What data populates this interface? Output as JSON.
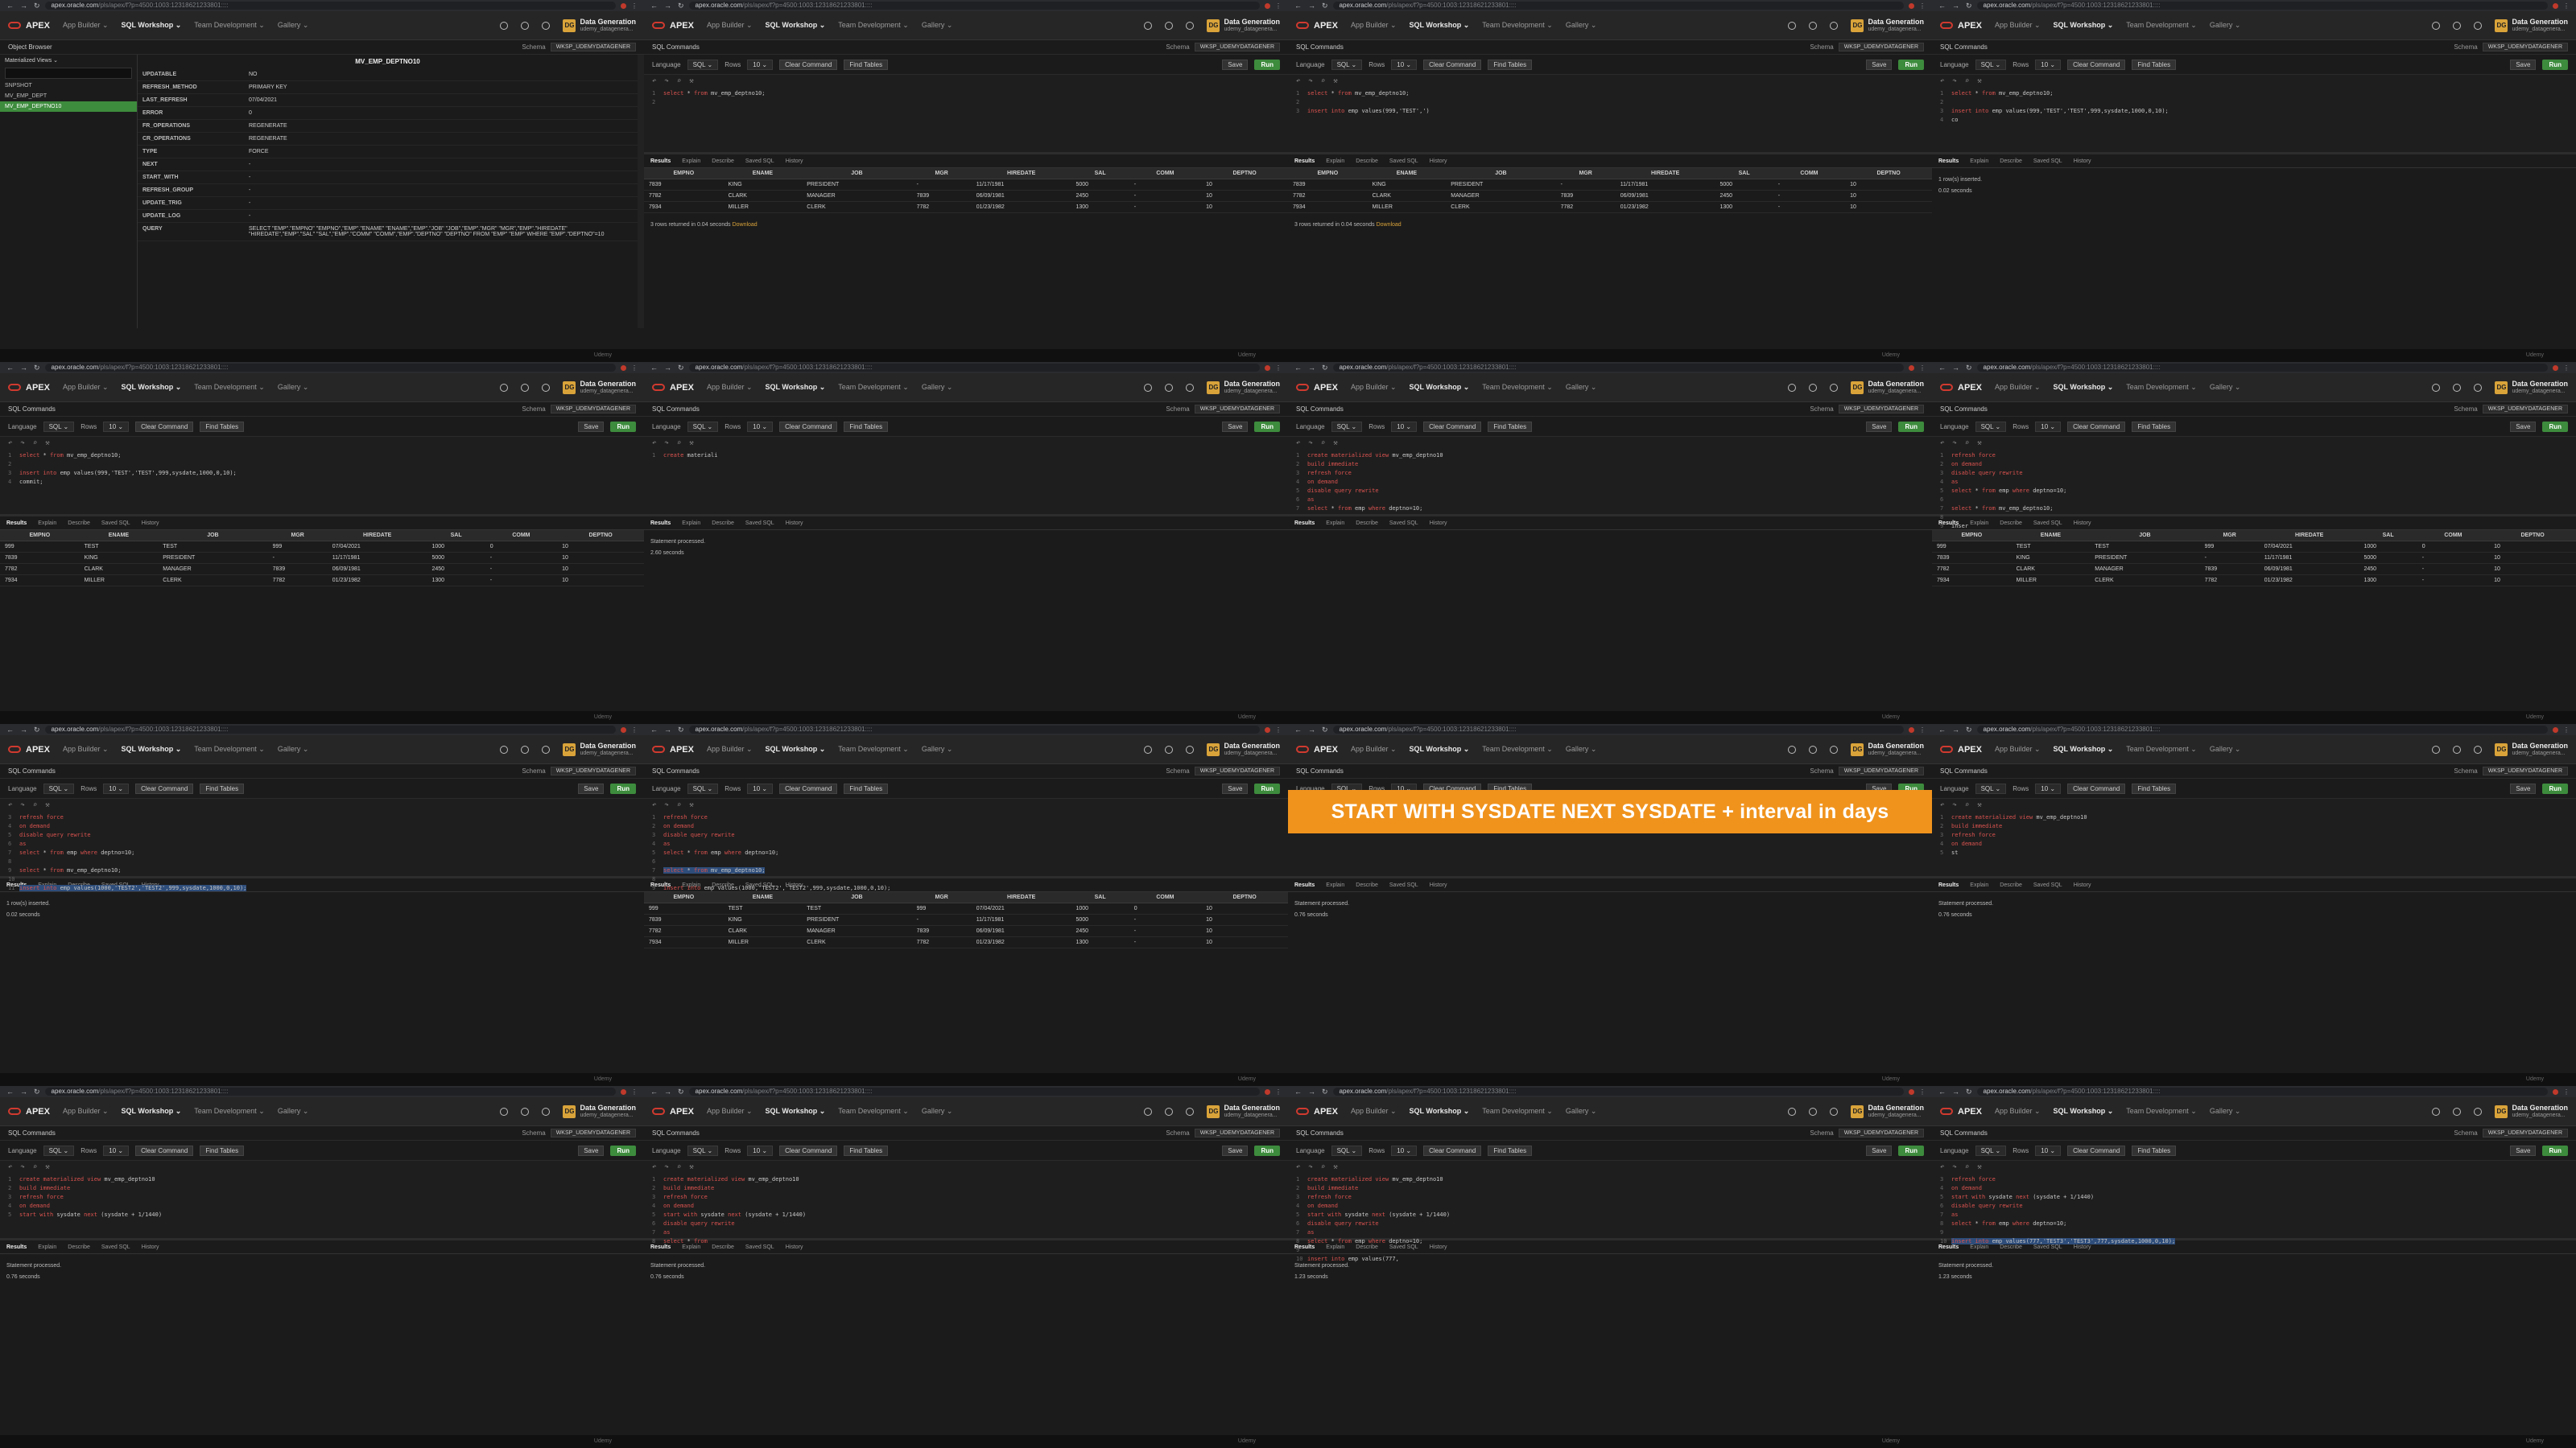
{
  "browser": {
    "url_host": "apex.oracle.com",
    "url_rest": "/pls/apex/f?p=4500:1003:12318621233801::::"
  },
  "apex": {
    "logo": "APEX",
    "menus": [
      "App Builder",
      "SQL Workshop",
      "Team Development",
      "Gallery"
    ],
    "active_menu": "SQL Workshop",
    "workspace_badge": "DG",
    "workspace_title": "Data Generation",
    "workspace_user": "udemy_datagenera..."
  },
  "page": {
    "title": "SQL Commands",
    "schema_label": "Schema",
    "schema_value": "WKSP_UDEMYDATAGENER"
  },
  "toolbar": {
    "language_label": "Language",
    "language_value": "SQL",
    "rows_label": "Rows",
    "rows_value": "10",
    "clear_label": "Clear Command",
    "find_label": "Find Tables",
    "save_label": "Save",
    "run_label": "Run"
  },
  "result_tabs": [
    "Results",
    "Explain",
    "Describe",
    "Saved SQL",
    "History"
  ],
  "footer_brand": "Udemy",
  "emp_columns": [
    "EMPNO",
    "ENAME",
    "JOB",
    "MGR",
    "HIREDATE",
    "SAL",
    "COMM",
    "DEPTNO"
  ],
  "object_browser": {
    "title": "Object Browser",
    "view_select": "Materialized Views",
    "items": [
      "SNPSHOT",
      "MV_EMP_DEPT",
      "MV_EMP_DEPTNO10"
    ],
    "selected_item": "MV_EMP_DEPTNO10",
    "heading": "MV_EMP_DEPTNO10",
    "properties": [
      {
        "k": "UPDATABLE",
        "v": "NO"
      },
      {
        "k": "REFRESH_METHOD",
        "v": "PRIMARY KEY"
      },
      {
        "k": "LAST_REFRESH",
        "v": "07/04/2021"
      },
      {
        "k": "ERROR",
        "v": "0"
      },
      {
        "k": "FR_OPERATIONS",
        "v": "REGENERATE"
      },
      {
        "k": "CR_OPERATIONS",
        "v": "REGENERATE"
      },
      {
        "k": "TYPE",
        "v": "FORCE"
      },
      {
        "k": "NEXT",
        "v": "-"
      },
      {
        "k": "START_WITH",
        "v": "-"
      },
      {
        "k": "REFRESH_GROUP",
        "v": "-"
      },
      {
        "k": "UPDATE_TRIG",
        "v": "-"
      },
      {
        "k": "UPDATE_LOG",
        "v": "-"
      },
      {
        "k": "QUERY",
        "v": "SELECT \"EMP\".\"EMPNO\" \"EMPNO\",\"EMP\".\"ENAME\" \"ENAME\",\"EMP\".\"JOB\" \"JOB\",\"EMP\".\"MGR\" \"MGR\",\"EMP\".\"HIREDATE\" \"HIREDATE\",\"EMP\".\"SAL\" \"SAL\",\"EMP\".\"COMM\" \"COMM\",\"EMP\".\"DEPTNO\" \"DEPTNO\" FROM \"EMP\" \"EMP\" WHERE \"EMP\".\"DEPTNO\"=10"
      }
    ]
  },
  "banner_text": "START WITH SYSDATE NEXT SYSDATE + interval in days",
  "tiles": [
    {
      "kind": "objbrowser"
    },
    {
      "kind": "sql",
      "code": [
        {
          "n": "1",
          "t": "select * from mv_emp_deptno10;"
        },
        {
          "n": "2",
          "t": ""
        }
      ],
      "result": "table",
      "rows": [
        [
          "7839",
          "KING",
          "PRESIDENT",
          "-",
          "11/17/1981",
          "5000",
          "-",
          "10"
        ],
        [
          "7782",
          "CLARK",
          "MANAGER",
          "7839",
          "06/09/1981",
          "2450",
          "-",
          "10"
        ],
        [
          "7934",
          "MILLER",
          "CLERK",
          "7782",
          "01/23/1982",
          "1300",
          "-",
          "10"
        ]
      ],
      "status": "3 rows returned in 0.04 seconds",
      "download": "Download"
    },
    {
      "kind": "sql",
      "code": [
        {
          "n": "1",
          "t": "select * from mv_emp_deptno10;"
        },
        {
          "n": "2",
          "t": ""
        },
        {
          "n": "3",
          "t": "insert into emp values(999,'TEST',')"
        }
      ],
      "result": "table",
      "rows": [
        [
          "7839",
          "KING",
          "PRESIDENT",
          "-",
          "11/17/1981",
          "5000",
          "-",
          "10"
        ],
        [
          "7782",
          "CLARK",
          "MANAGER",
          "7839",
          "06/09/1981",
          "2450",
          "-",
          "10"
        ],
        [
          "7934",
          "MILLER",
          "CLERK",
          "7782",
          "01/23/1982",
          "1300",
          "-",
          "10"
        ]
      ],
      "status": "3 rows returned in 0.04 seconds",
      "download": "Download"
    },
    {
      "kind": "sql",
      "code": [
        {
          "n": "1",
          "t": "select * from mv_emp_deptno10;"
        },
        {
          "n": "2",
          "t": ""
        },
        {
          "n": "3",
          "t": "insert into emp values(999,'TEST','TEST',999,sysdate,1000,0,10);"
        },
        {
          "n": "4",
          "t": "co"
        }
      ],
      "result": "msg",
      "messages": [
        "1 row(s) inserted.",
        "0.02 seconds"
      ]
    },
    {
      "kind": "sql",
      "code": [
        {
          "n": "1",
          "t": "select * from mv_emp_deptno10;"
        },
        {
          "n": "2",
          "t": ""
        },
        {
          "n": "3",
          "t": "insert into emp values(999,'TEST','TEST',999,sysdate,1000,0,10);"
        },
        {
          "n": "4",
          "t": "commit;"
        }
      ],
      "result": "table",
      "rows": [
        [
          "999",
          "TEST",
          "TEST",
          "999",
          "07/04/2021",
          "1000",
          "0",
          "10"
        ],
        [
          "7839",
          "KING",
          "PRESIDENT",
          "-",
          "11/17/1981",
          "5000",
          "-",
          "10"
        ],
        [
          "7782",
          "CLARK",
          "MANAGER",
          "7839",
          "06/09/1981",
          "2450",
          "-",
          "10"
        ],
        [
          "7934",
          "MILLER",
          "CLERK",
          "7782",
          "01/23/1982",
          "1300",
          "-",
          "10"
        ]
      ],
      "status": "",
      "download": ""
    },
    {
      "kind": "sql",
      "code": [
        {
          "n": "1",
          "t": "create materiali"
        }
      ],
      "result": "msg",
      "messages": [
        "Statement processed.",
        "2.60 seconds"
      ]
    },
    {
      "kind": "sql",
      "code": [
        {
          "n": "1",
          "t": "create materialized view mv_emp_deptno10"
        },
        {
          "n": "2",
          "t": "build immediate"
        },
        {
          "n": "3",
          "t": "refresh force"
        },
        {
          "n": "4",
          "t": "on demand"
        },
        {
          "n": "5",
          "t": "disable query rewrite"
        },
        {
          "n": "6",
          "t": "as"
        },
        {
          "n": "7",
          "t": "select * from emp where deptno=10;"
        }
      ],
      "result": "none"
    },
    {
      "kind": "sql",
      "code": [
        {
          "n": "1",
          "t": "refresh force"
        },
        {
          "n": "2",
          "t": "on demand"
        },
        {
          "n": "3",
          "t": "disable query rewrite"
        },
        {
          "n": "4",
          "t": "as"
        },
        {
          "n": "5",
          "t": "select * from emp where deptno=10;"
        },
        {
          "n": "6",
          "t": ""
        },
        {
          "n": "7",
          "t": "select * from mv_emp_deptno10;"
        },
        {
          "n": "8",
          "t": ""
        },
        {
          "n": "9",
          "t": "inser"
        }
      ],
      "result": "table",
      "rows": [
        [
          "999",
          "TEST",
          "TEST",
          "999",
          "07/04/2021",
          "1000",
          "0",
          "10"
        ],
        [
          "7839",
          "KING",
          "PRESIDENT",
          "-",
          "11/17/1981",
          "5000",
          "-",
          "10"
        ],
        [
          "7782",
          "CLARK",
          "MANAGER",
          "7839",
          "06/09/1981",
          "2450",
          "-",
          "10"
        ],
        [
          "7934",
          "MILLER",
          "CLERK",
          "7782",
          "01/23/1982",
          "1300",
          "-",
          "10"
        ]
      ],
      "status": "",
      "download": ""
    },
    {
      "kind": "sql",
      "code": [
        {
          "n": "3",
          "t": "refresh force"
        },
        {
          "n": "4",
          "t": "on demand"
        },
        {
          "n": "5",
          "t": "disable query rewrite"
        },
        {
          "n": "6",
          "t": "as"
        },
        {
          "n": "7",
          "t": "select * from emp where deptno=10;"
        },
        {
          "n": "8",
          "t": ""
        },
        {
          "n": "9",
          "t": "select * from mv_emp_deptno10;"
        },
        {
          "n": "10",
          "t": ""
        },
        {
          "n": "11",
          "t": "insert into emp values(1000,'TEST2','TEST2',999,sysdate,1000,0,10);",
          "hl": true
        }
      ],
      "result": "msg",
      "messages": [
        "1 row(s) inserted.",
        "0.02 seconds"
      ]
    },
    {
      "kind": "sql",
      "code": [
        {
          "n": "1",
          "t": "refresh force"
        },
        {
          "n": "2",
          "t": "on demand"
        },
        {
          "n": "3",
          "t": "disable query rewrite"
        },
        {
          "n": "4",
          "t": "as"
        },
        {
          "n": "5",
          "t": "select * from emp where deptno=10;"
        },
        {
          "n": "6",
          "t": ""
        },
        {
          "n": "7",
          "t": "select * from mv_emp_deptno10;",
          "hl": true
        },
        {
          "n": "8",
          "t": ""
        },
        {
          "n": "9",
          "t": "insert into emp values(1000,'TEST2','TEST2',999,sysdate,1000,0,10);"
        }
      ],
      "result": "table",
      "rows": [
        [
          "999",
          "TEST",
          "TEST",
          "999",
          "07/04/2021",
          "1000",
          "0",
          "10"
        ],
        [
          "7839",
          "KING",
          "PRESIDENT",
          "-",
          "11/17/1981",
          "5000",
          "-",
          "10"
        ],
        [
          "7782",
          "CLARK",
          "MANAGER",
          "7839",
          "06/09/1981",
          "2450",
          "-",
          "10"
        ],
        [
          "7934",
          "MILLER",
          "CLERK",
          "7782",
          "01/23/1982",
          "1300",
          "-",
          "10"
        ]
      ],
      "status": "",
      "download": ""
    },
    {
      "kind": "sql",
      "banner": true,
      "code": [
        {
          "n": "1",
          "t": "drop materialized view mv_emp_deptno10;",
          "hl": true
        }
      ],
      "result": "msg",
      "messages": [
        "Statement processed.",
        "0.76 seconds"
      ]
    },
    {
      "kind": "sql",
      "code": [
        {
          "n": "1",
          "t": "create materialized view mv_emp_deptno10"
        },
        {
          "n": "2",
          "t": "build immediate"
        },
        {
          "n": "3",
          "t": "refresh force"
        },
        {
          "n": "4",
          "t": "on demand"
        },
        {
          "n": "5",
          "t": "st"
        }
      ],
      "result": "msg",
      "messages": [
        "Statement processed.",
        "0.76 seconds"
      ]
    },
    {
      "kind": "sql",
      "code": [
        {
          "n": "1",
          "t": "create materialized view mv_emp_deptno10"
        },
        {
          "n": "2",
          "t": "build immediate"
        },
        {
          "n": "3",
          "t": "refresh force"
        },
        {
          "n": "4",
          "t": "on demand"
        },
        {
          "n": "5",
          "t": "start with sysdate next (sysdate + 1/1440)"
        }
      ],
      "result": "msg",
      "messages": [
        "Statement processed.",
        "0.76 seconds"
      ]
    },
    {
      "kind": "sql",
      "code": [
        {
          "n": "1",
          "t": "create materialized view mv_emp_deptno10"
        },
        {
          "n": "2",
          "t": "build immediate"
        },
        {
          "n": "3",
          "t": "refresh force"
        },
        {
          "n": "4",
          "t": "on demand"
        },
        {
          "n": "5",
          "t": "start with sysdate next (sysdate + 1/1440)"
        },
        {
          "n": "6",
          "t": "disable query rewrite"
        },
        {
          "n": "7",
          "t": "as"
        },
        {
          "n": "8",
          "t": "select * from"
        }
      ],
      "result": "msg",
      "messages": [
        "Statement processed.",
        "0.76 seconds"
      ]
    },
    {
      "kind": "sql",
      "code": [
        {
          "n": "1",
          "t": "create materialized view mv_emp_deptno10"
        },
        {
          "n": "2",
          "t": "build immediate"
        },
        {
          "n": "3",
          "t": "refresh force"
        },
        {
          "n": "4",
          "t": "on demand"
        },
        {
          "n": "5",
          "t": "start with sysdate next (sysdate + 1/1440)"
        },
        {
          "n": "6",
          "t": "disable query rewrite"
        },
        {
          "n": "7",
          "t": "as"
        },
        {
          "n": "8",
          "t": "select * from emp where deptno=10;"
        },
        {
          "n": "9",
          "t": ""
        },
        {
          "n": "10",
          "t": "insert into emp values(777,"
        }
      ],
      "result": "msg",
      "messages": [
        "Statement processed.",
        "1.23 seconds"
      ]
    },
    {
      "kind": "sql",
      "code": [
        {
          "n": "3",
          "t": "refresh force"
        },
        {
          "n": "4",
          "t": "on demand"
        },
        {
          "n": "5",
          "t": "start with sysdate next (sysdate + 1/1440)"
        },
        {
          "n": "6",
          "t": "disable query rewrite"
        },
        {
          "n": "7",
          "t": "as"
        },
        {
          "n": "8",
          "t": "select * from emp where deptno=10;"
        },
        {
          "n": "9",
          "t": ""
        },
        {
          "n": "10",
          "t": "insert into emp values(777,'TEST3','TEST3',777,sysdate,1000,0,10);",
          "hl": true
        }
      ],
      "result": "msg",
      "messages": [
        "Statement processed.",
        "1.23 seconds"
      ]
    }
  ]
}
